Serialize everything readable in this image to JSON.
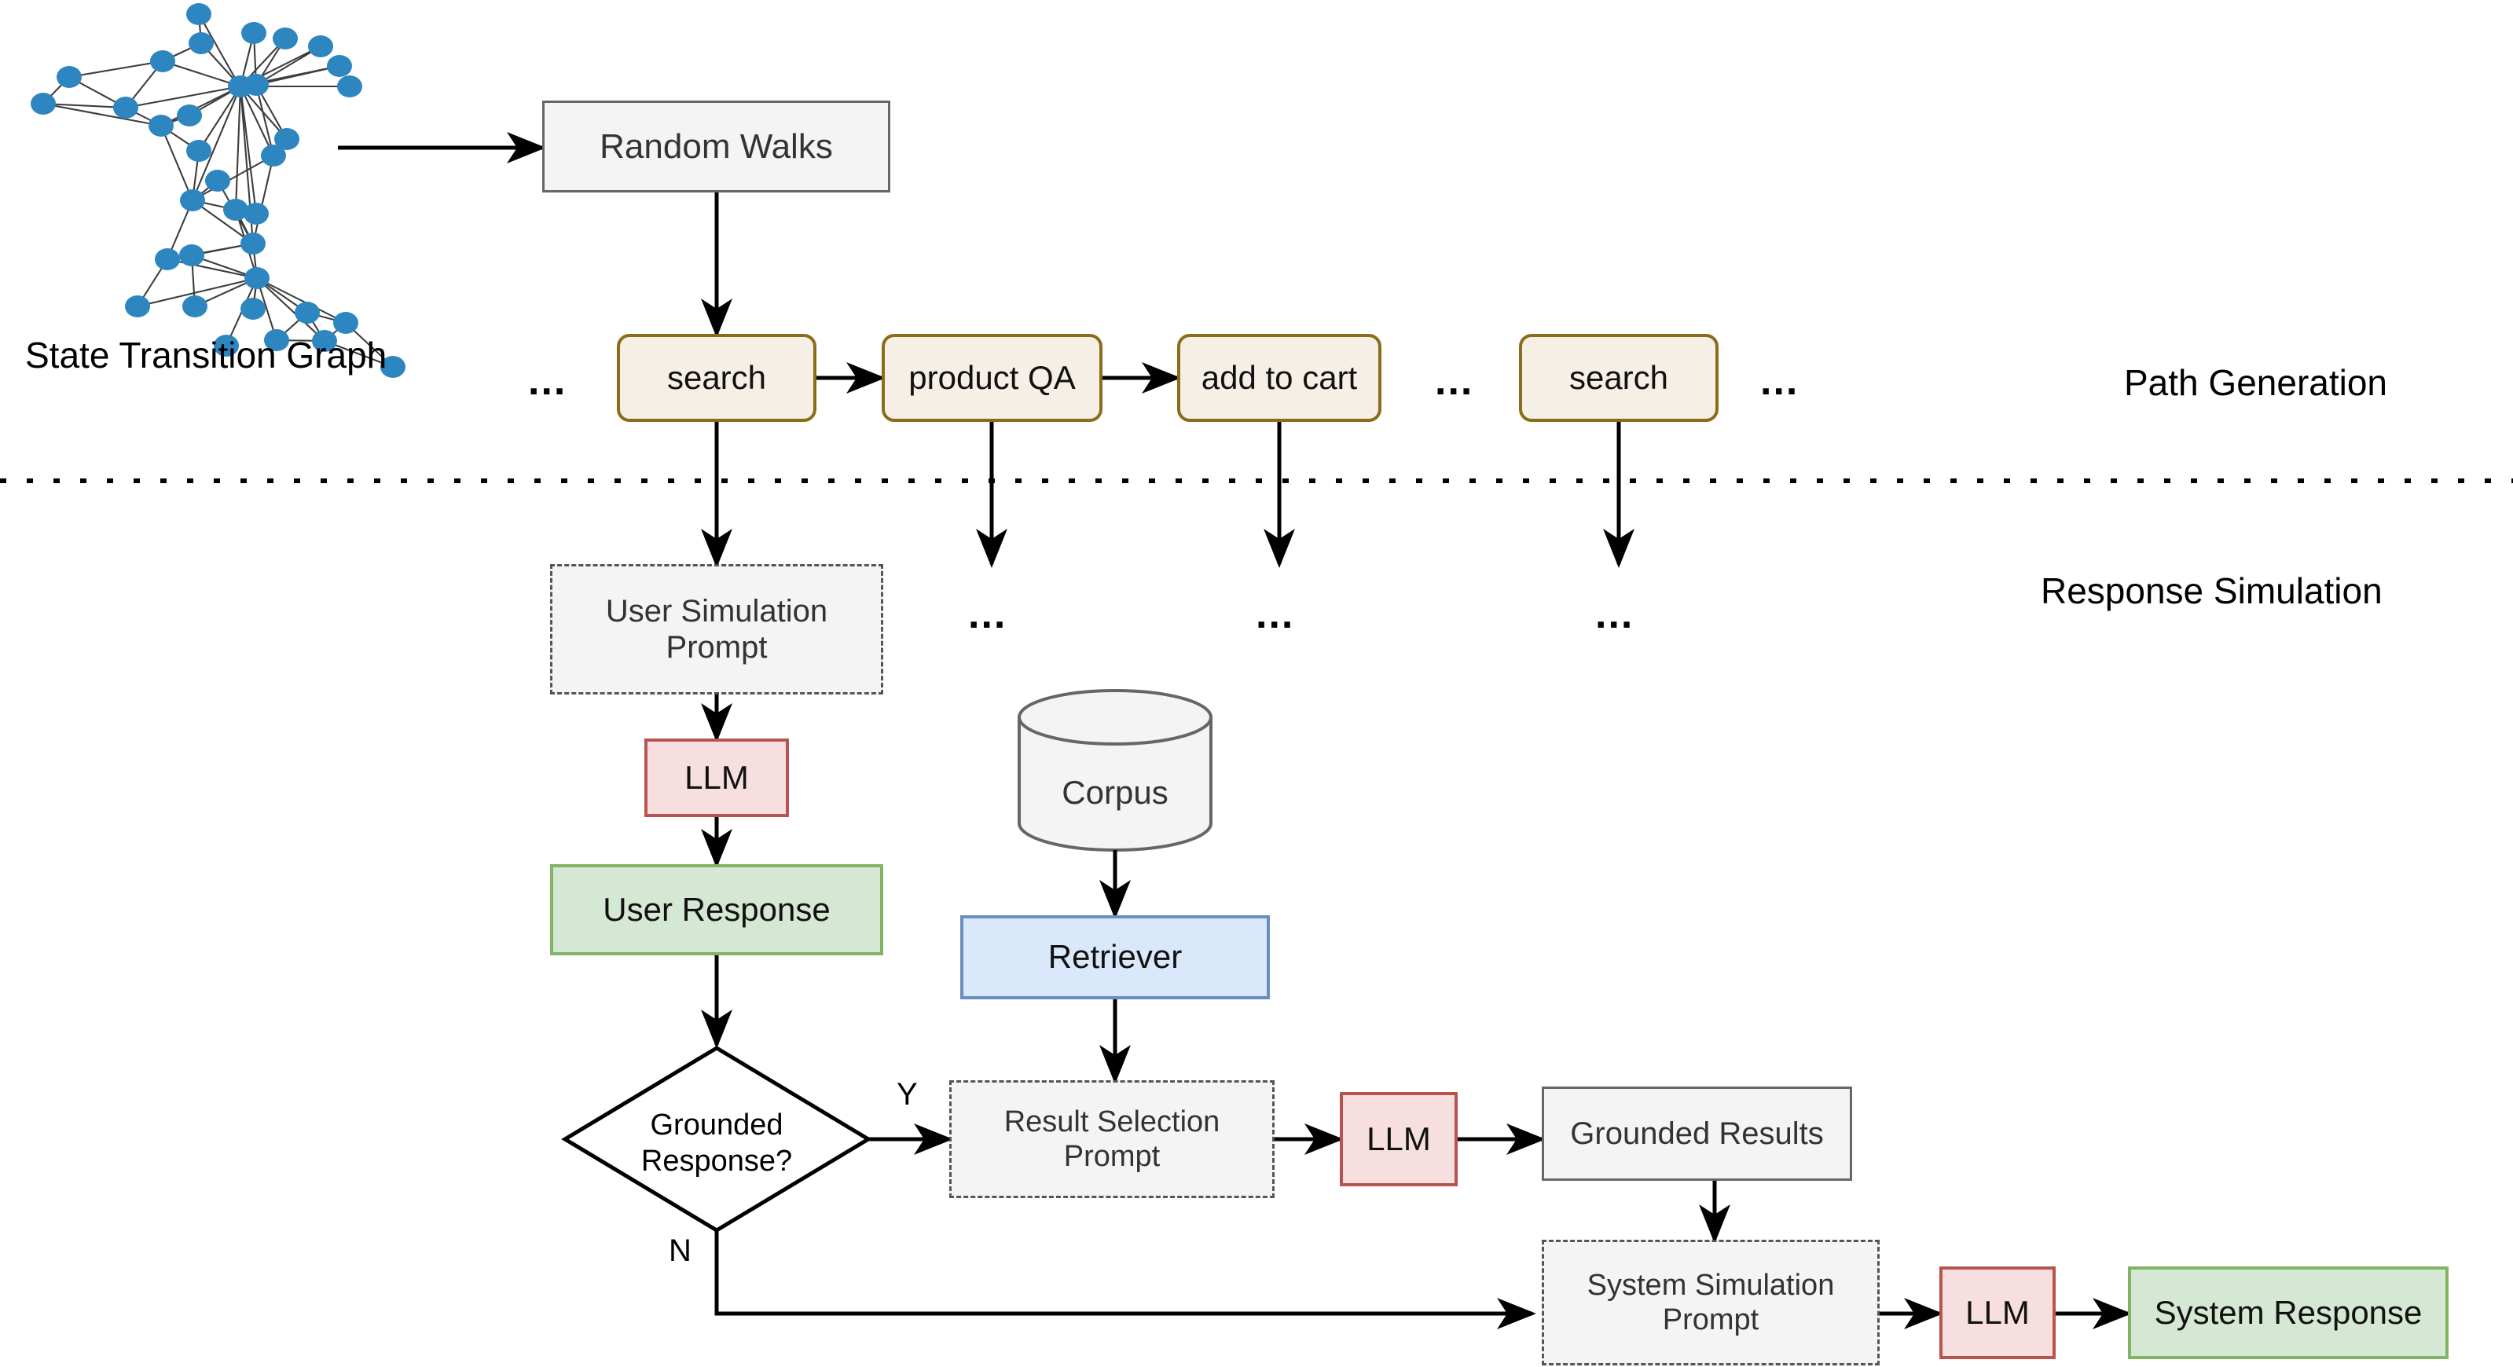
{
  "diagram": {
    "title_left_caption": "State Transition Graph",
    "stage_labels": {
      "path_generation": "Path Generation",
      "response_simulation": "Response Simulation"
    },
    "random_walks": "Random Walks",
    "path_nodes": [
      {
        "label": "search"
      },
      {
        "label": "product QA"
      },
      {
        "label": "add to cart"
      },
      {
        "label": "search"
      }
    ],
    "ellipses": {
      "path_leading": "...",
      "path_middle": "...",
      "path_trailing": "...",
      "sim_1": "...",
      "sim_2": "...",
      "sim_3": "..."
    },
    "user_simulation_prompt": "User Simulation\nPrompt",
    "user_simulation_prompt_line1": "User Simulation",
    "user_simulation_prompt_line2": "Prompt",
    "llm_user": "LLM",
    "user_response": "User Response",
    "decision": {
      "line1": "Grounded",
      "line2": "Response?",
      "yes_label": "Y",
      "no_label": "N"
    },
    "corpus": "Corpus",
    "retriever": "Retriever",
    "result_selection_prompt_line1": "Result Selection",
    "result_selection_prompt_line2": "Prompt",
    "llm_result": "LLM",
    "grounded_results": "Grounded Results",
    "system_simulation_prompt_line1": "System Simulation",
    "system_simulation_prompt_line2": "Prompt",
    "llm_system": "LLM",
    "system_response": "System Response"
  },
  "colors": {
    "graph_node": "#2e86c1",
    "graph_edge": "#333333",
    "gray_fill": "#f4f4f4",
    "gray_stroke": "#666666",
    "tan_fill": "#f5efe6",
    "tan_stroke": "#8a6d1a",
    "red_fill": "#f8dfdf",
    "red_stroke": "#b85450",
    "green_fill": "#d5e8d4",
    "green_stroke": "#82b366",
    "blue_fill": "#dae8fc",
    "blue_stroke": "#6c8ebf",
    "arrow": "#000000",
    "divider": "#000000"
  }
}
